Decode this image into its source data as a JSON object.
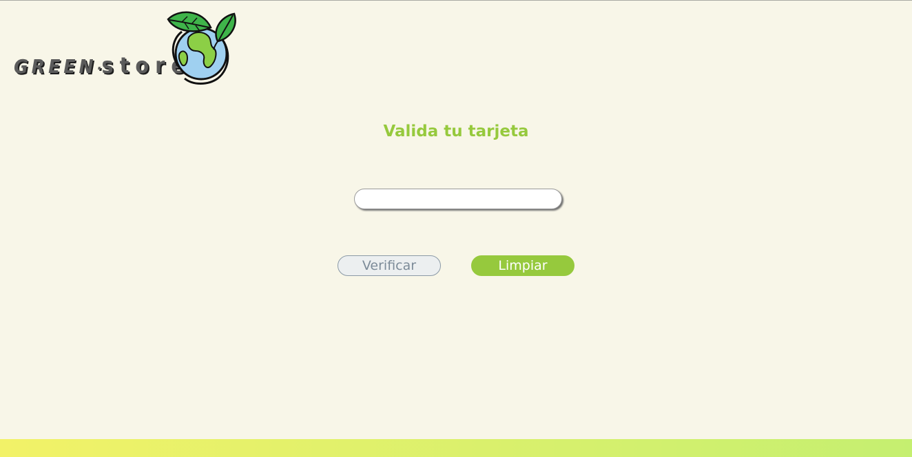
{
  "logo": {
    "brand_part1": "GREEN",
    "separator": "·",
    "brand_part2": "store",
    "icon": "earth-globe-with-leaves-icon"
  },
  "main": {
    "title": "Valida tu tarjeta",
    "card_input": {
      "value": "",
      "placeholder": ""
    },
    "verify_label": "Verificar",
    "clear_label": "Limpiar"
  },
  "colors": {
    "background": "#f8f6e8",
    "accent": "#96c93d",
    "verify_border": "#8a99a6",
    "footer_gradient_start": "#f2f268",
    "footer_gradient_end": "#c5ef70"
  }
}
